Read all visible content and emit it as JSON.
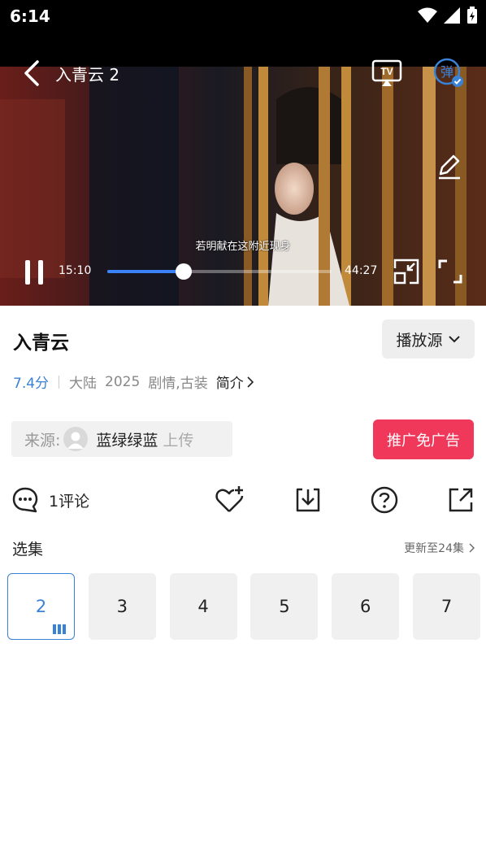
{
  "status_bar": {
    "time": "6:14"
  },
  "player": {
    "title": "入青云 2",
    "subtitle_text": "若明献在这附近现身",
    "current_time": "15:10",
    "total_time": "44:27",
    "progress": 0.34,
    "danmu_label": "弹",
    "tv_label": "TV"
  },
  "show": {
    "title": "入青云",
    "source_button": "播放源",
    "score": "7.4分",
    "region": "大陆",
    "year": "2025",
    "genres": "剧情,古装",
    "intro_label": "简介"
  },
  "uploader": {
    "label": "来源:",
    "name": "蓝绿绿蓝",
    "suffix": "上传"
  },
  "ad_button": "推广免广告",
  "actions": {
    "comments": "1评论"
  },
  "episodes": {
    "header": "选集",
    "update": "更新至24集",
    "items": [
      {
        "label": "2",
        "active": true
      },
      {
        "label": "3",
        "active": false
      },
      {
        "label": "4",
        "active": false
      },
      {
        "label": "5",
        "active": false
      },
      {
        "label": "6",
        "active": false
      },
      {
        "label": "7",
        "active": false
      }
    ]
  },
  "colors": {
    "accent": "#3a82d6",
    "ad_red": "#f0385a"
  }
}
